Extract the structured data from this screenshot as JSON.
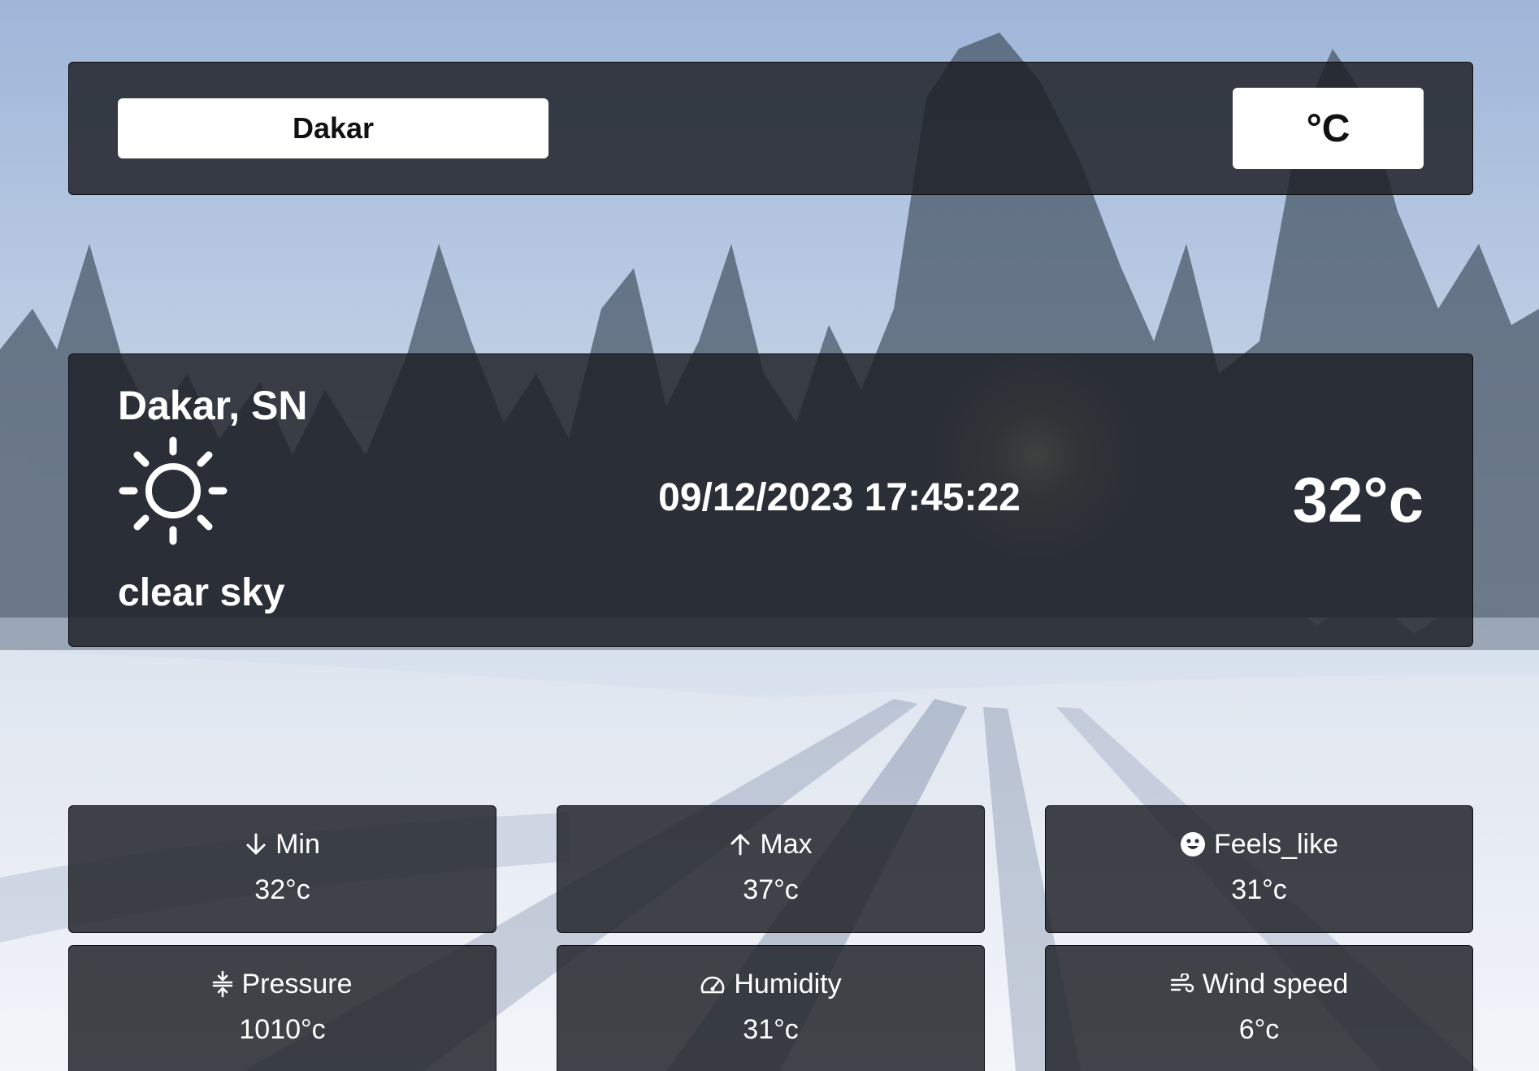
{
  "search": {
    "city_value": "Dakar"
  },
  "unit_toggle": {
    "label": "°C"
  },
  "current": {
    "location": "Dakar, SN",
    "icon": "sun-icon",
    "condition": "clear sky",
    "datetime": "09/12/2023 17:45:22",
    "temperature": "32°c"
  },
  "stats": [
    {
      "icon": "arrow-down-icon",
      "label": "Min",
      "value": "32°c"
    },
    {
      "icon": "arrow-up-icon",
      "label": "Max",
      "value": "37°c"
    },
    {
      "icon": "smiley-icon",
      "label": "Feels_like",
      "value": "31°c"
    },
    {
      "icon": "compress-icon",
      "label": "Pressure",
      "value": "1010°c"
    },
    {
      "icon": "gauge-icon",
      "label": "Humidity",
      "value": "31°c"
    },
    {
      "icon": "wind-icon",
      "label": "Wind speed",
      "value": "6°c"
    }
  ],
  "colors": {
    "panel_background": "#1e2026",
    "text": "#ffffff",
    "input_background": "#ffffff",
    "input_text": "#111111"
  }
}
